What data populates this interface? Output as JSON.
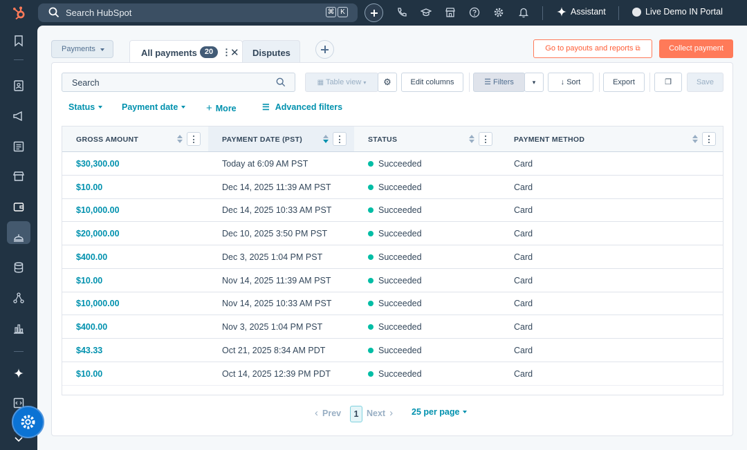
{
  "topbar": {
    "search_placeholder": "Search HubSpot",
    "shortcut_keys": [
      "⌘",
      "K"
    ],
    "assistant_label": "Assistant",
    "portal_label": "Live Demo IN Portal"
  },
  "toolbar": {
    "view_selector": "Payments",
    "tabs": [
      {
        "label": "All payments",
        "count": "20"
      },
      {
        "label": "Disputes"
      }
    ],
    "payouts_button": "Go to payouts and reports",
    "collect_button": "Collect payment"
  },
  "controls": {
    "search_placeholder": "Search",
    "table_view": "Table view",
    "edit_columns": "Edit columns",
    "filters": "Filters",
    "sort": "Sort",
    "export": "Export",
    "save": "Save"
  },
  "filters": {
    "status": "Status",
    "payment_date": "Payment date",
    "more": "More",
    "advanced": "Advanced filters"
  },
  "table": {
    "columns": [
      "GROSS AMOUNT",
      "PAYMENT DATE (PST)",
      "STATUS",
      "PAYMENT METHOD"
    ],
    "rows": [
      {
        "amount": "$30,300.00",
        "date": "Today at 6:09 AM PST",
        "status": "Succeeded",
        "method": "Card"
      },
      {
        "amount": "$10.00",
        "date": "Dec 14, 2025 11:39 AM PST",
        "status": "Succeeded",
        "method": "Card"
      },
      {
        "amount": "$10,000.00",
        "date": "Dec 14, 2025 10:33 AM PST",
        "status": "Succeeded",
        "method": "Card"
      },
      {
        "amount": "$20,000.00",
        "date": "Dec 10, 2025 3:50 PM PST",
        "status": "Succeeded",
        "method": "Card"
      },
      {
        "amount": "$400.00",
        "date": "Dec 3, 2025 1:04 PM PST",
        "status": "Succeeded",
        "method": "Card"
      },
      {
        "amount": "$10.00",
        "date": "Nov 14, 2025 11:39 AM PST",
        "status": "Succeeded",
        "method": "Card"
      },
      {
        "amount": "$10,000.00",
        "date": "Nov 14, 2025 10:33 AM PST",
        "status": "Succeeded",
        "method": "Card"
      },
      {
        "amount": "$400.00",
        "date": "Nov 3, 2025 1:04 PM PST",
        "status": "Succeeded",
        "method": "Card"
      },
      {
        "amount": "$43.33",
        "date": "Oct 21, 2025 8:34 AM PDT",
        "status": "Succeeded",
        "method": "Card"
      },
      {
        "amount": "$10.00",
        "date": "Oct 14, 2025 12:39 PM PDT",
        "status": "Succeeded",
        "method": "Card"
      }
    ]
  },
  "pagination": {
    "prev": "Prev",
    "page": "1",
    "next": "Next",
    "per_page": "25 per page"
  },
  "colors": {
    "accent": "#0091ae",
    "brand_orange": "#ff7a59",
    "status_success": "#00bda5",
    "nav_bg": "#213343"
  }
}
